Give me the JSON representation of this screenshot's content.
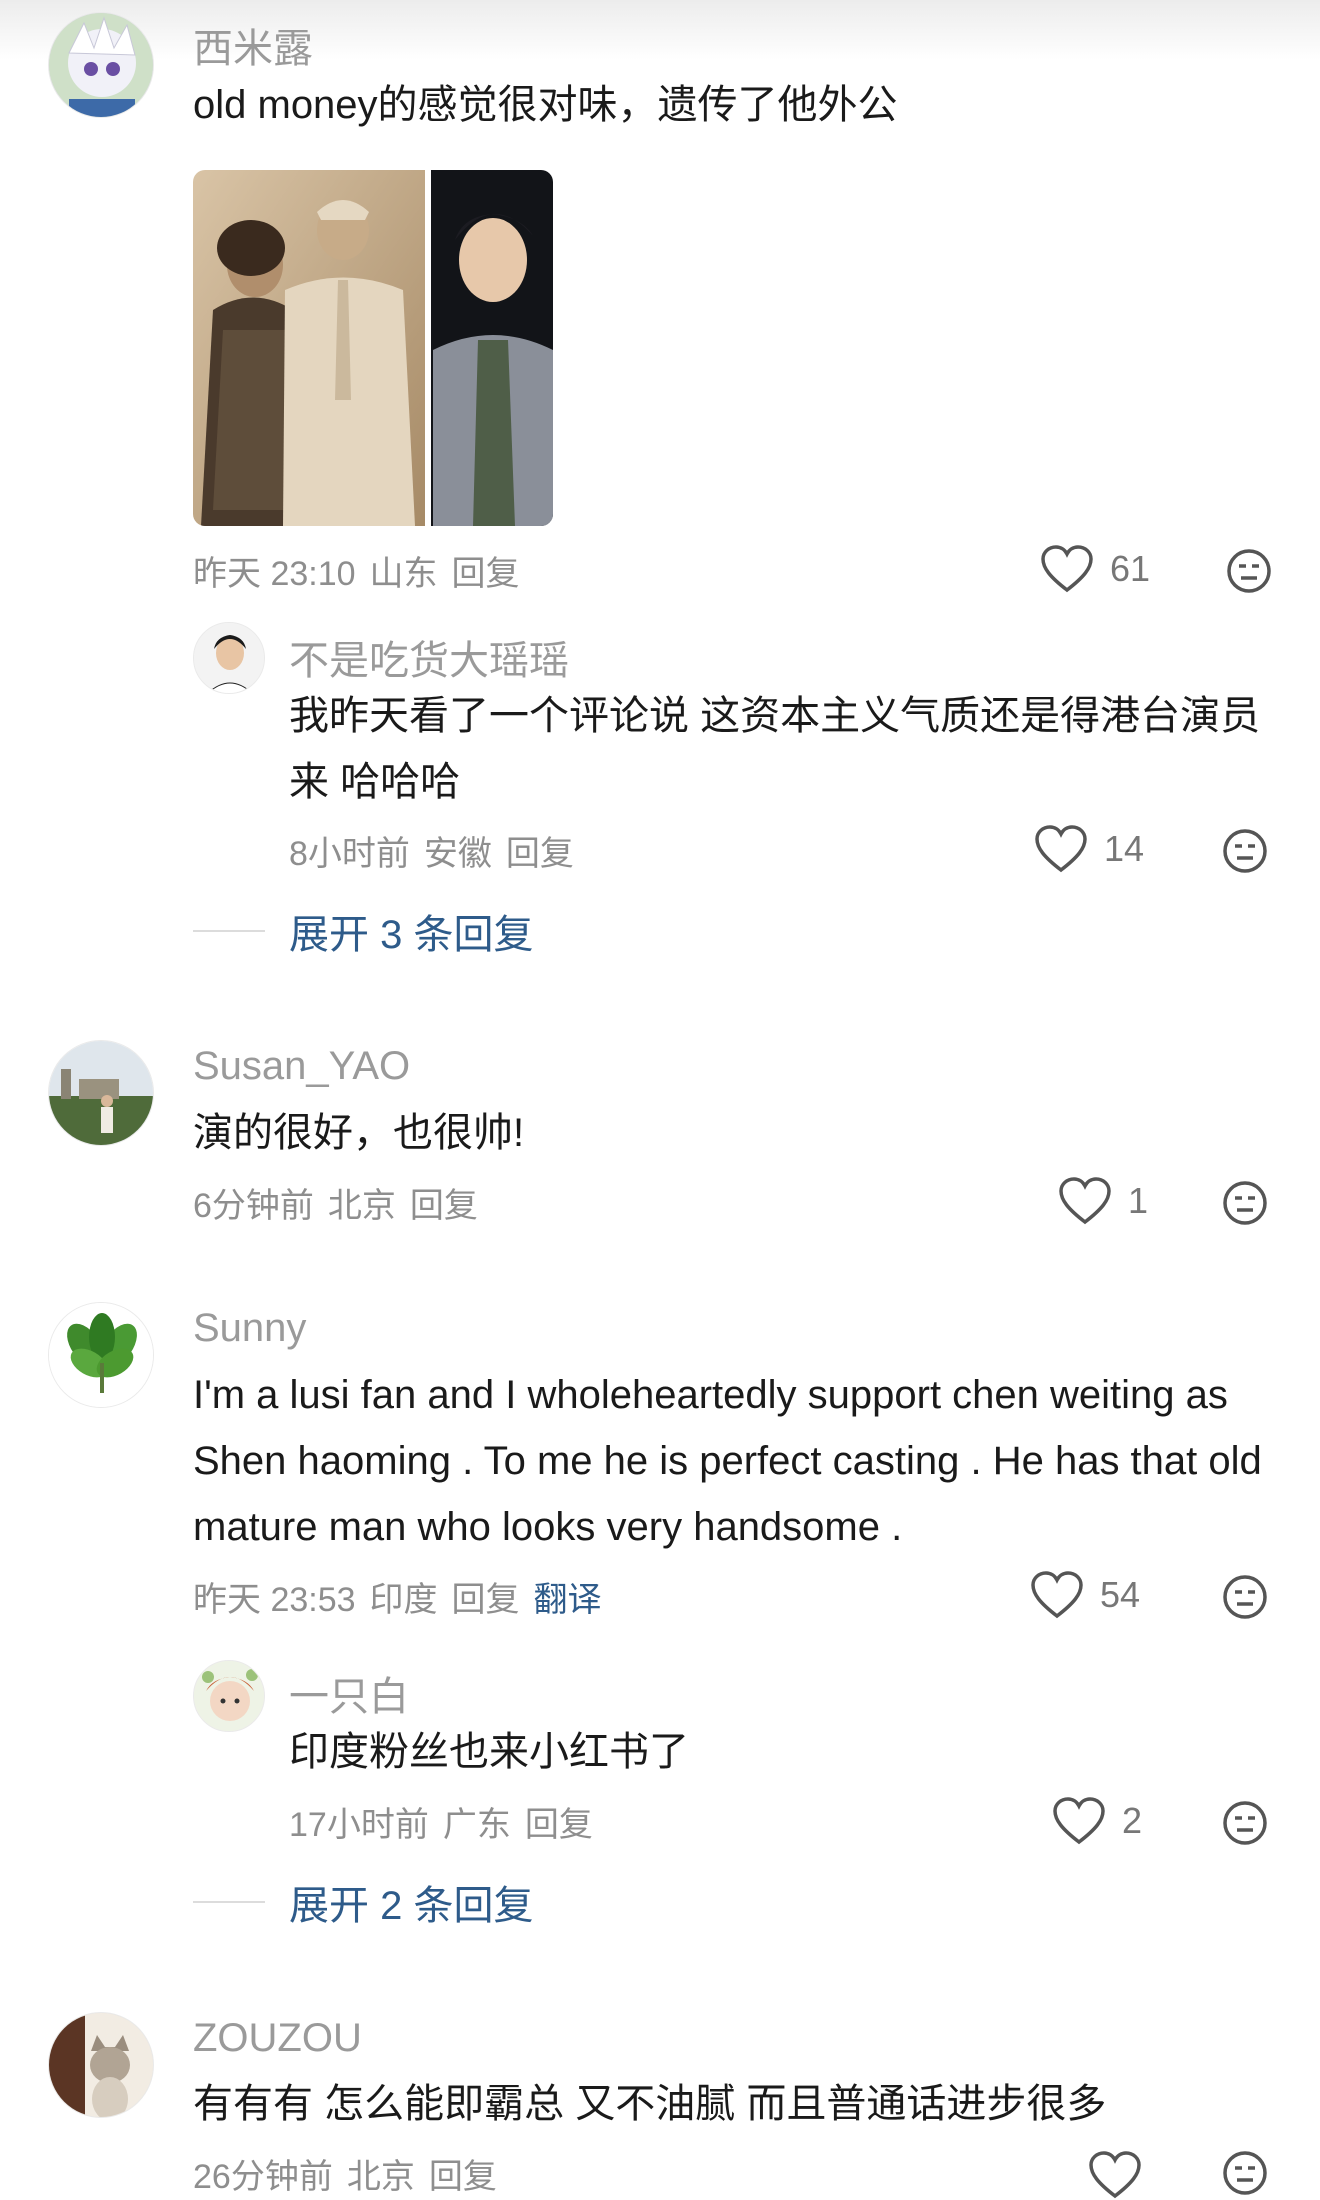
{
  "comments": [
    {
      "username": "西米露",
      "text": "old money的感觉很对味，遗传了他外公",
      "time": "昨天 23:10",
      "location": "山东",
      "reply": "回复",
      "likes": "61",
      "replies": [
        {
          "username": "不是吃货大瑶瑶",
          "text": "我昨天看了一个评论说 这资本主义气质还是得港台演员来 哈哈哈",
          "time": "8小时前",
          "location": "安徽",
          "reply": "回复",
          "likes": "14"
        }
      ],
      "expand_label": "展开 3 条回复"
    },
    {
      "username": "Susan_YAO",
      "text": "演的很好，也很帅!",
      "time": "6分钟前",
      "location": "北京",
      "reply": "回复",
      "likes": "1"
    },
    {
      "username": "Sunny",
      "text": "I'm a lusi fan and I wholeheartedly support chen weiting as Shen haoming . To me he is perfect casting . He has that old mature man who looks very handsome .",
      "time": "昨天 23:53",
      "location": "印度",
      "reply": "回复",
      "translate": "翻译",
      "likes": "54",
      "replies": [
        {
          "username": "一只白",
          "text": "印度粉丝也来小红书了",
          "time": "17小时前",
          "location": "广东",
          "reply": "回复",
          "likes": "2"
        }
      ],
      "expand_label": "展开 2 条回复"
    },
    {
      "username": "ZOUZOU",
      "text": "有有有 怎么能即霸总 又不油腻 而且普通话进步很多",
      "time": "26分钟前",
      "location": "北京",
      "reply": "回复"
    }
  ],
  "colors": {
    "link": "#2e5b8a",
    "muted": "#8e8e8e",
    "name": "#9a9a9a",
    "text": "#1a1a1a"
  },
  "icons": {
    "like": "heart-outline-icon",
    "dislike": "unamused-face-icon"
  }
}
